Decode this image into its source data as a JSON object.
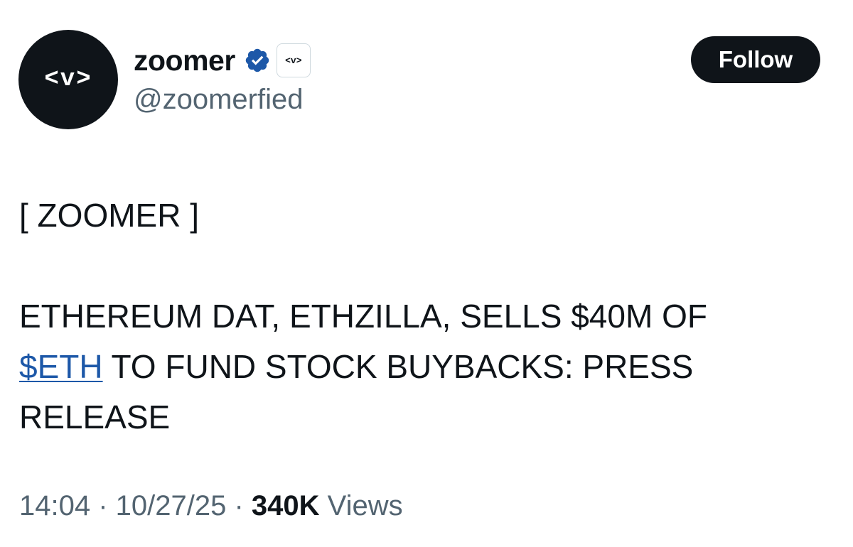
{
  "author": {
    "avatar_text": "<v>",
    "display_name": "zoomer",
    "verified": true,
    "affiliate_badge_text": "<v>",
    "handle": "@zoomerfied"
  },
  "actions": {
    "follow_label": "Follow"
  },
  "tweet": {
    "header": "[ ZOOMER ]",
    "line1": "ETHEREUM DAT, ETHZILLA, SELLS $40M OF",
    "cashtag": "$ETH",
    "line2_rest": " TO FUND STOCK BUYBACKS: PRESS RELEASE"
  },
  "meta": {
    "time": "14:04",
    "separator": " · ",
    "date": "10/27/25",
    "views_count": "340K",
    "views_label": " Views"
  },
  "colors": {
    "text": "#0f1419",
    "secondary": "#536471",
    "link": "#1d58a8",
    "verified_badge": "#1d58a8"
  },
  "icons": {
    "verified": "verified-badge-icon"
  }
}
